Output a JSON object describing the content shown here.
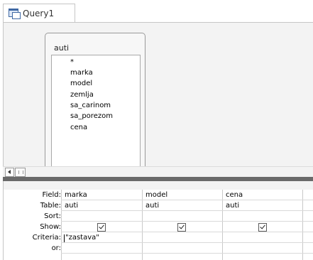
{
  "tab": {
    "title": "Query1"
  },
  "table": {
    "name": "auti",
    "fields": [
      "*",
      "marka",
      "model",
      "zemlja",
      "sa_carinom",
      "sa_porezom",
      "cena"
    ]
  },
  "grid": {
    "row_labels": {
      "field": "Field:",
      "table": "Table:",
      "sort": "Sort:",
      "show": "Show:",
      "criteria": "Criteria:",
      "or": "or:"
    },
    "columns": [
      {
        "field": "marka",
        "table": "auti",
        "sort": "",
        "show": true,
        "criteria": "\"zastava\""
      },
      {
        "field": "model",
        "table": "auti",
        "sort": "",
        "show": true,
        "criteria": ""
      },
      {
        "field": "cena",
        "table": "auti",
        "sort": "",
        "show": true,
        "criteria": ""
      }
    ]
  }
}
